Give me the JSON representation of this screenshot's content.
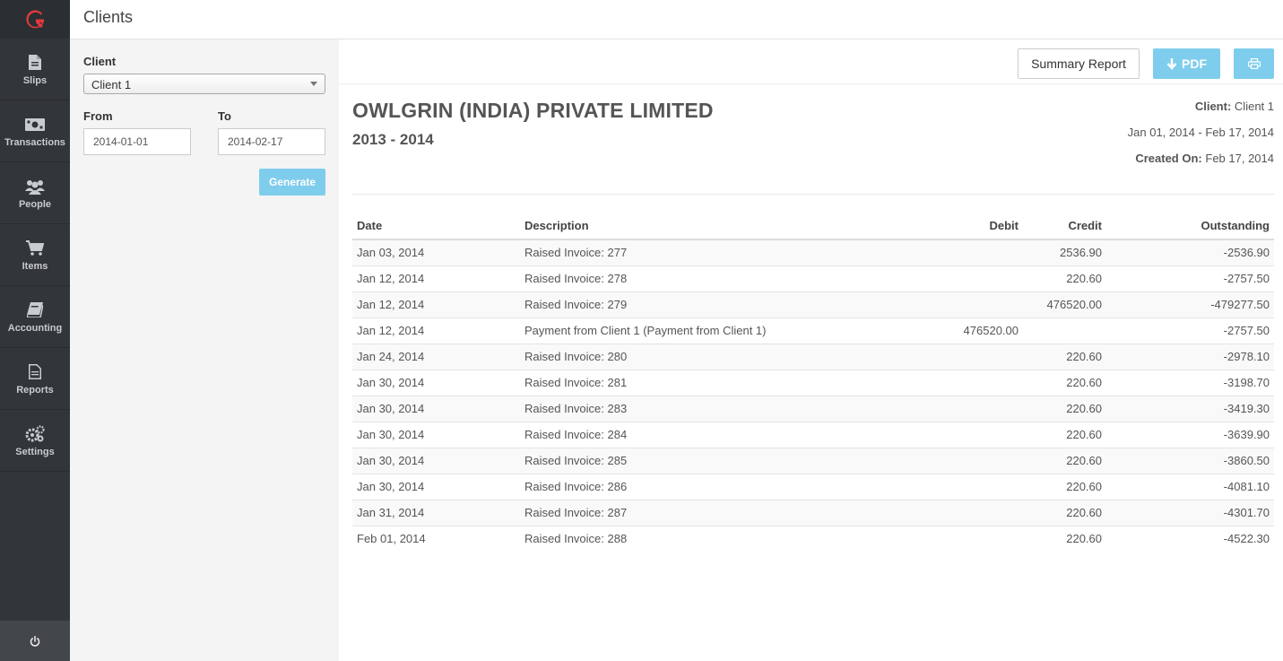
{
  "app": {
    "page_title": "Clients"
  },
  "sidebar": {
    "items": [
      {
        "label": "Slips",
        "icon": "file-icon"
      },
      {
        "label": "Transactions",
        "icon": "money-icon"
      },
      {
        "label": "People",
        "icon": "people-icon"
      },
      {
        "label": "Items",
        "icon": "cart-icon"
      },
      {
        "label": "Accounting",
        "icon": "book-icon"
      },
      {
        "label": "Reports",
        "icon": "report-icon"
      },
      {
        "label": "Settings",
        "icon": "gears-icon"
      }
    ]
  },
  "filter": {
    "client_label": "Client",
    "client_value": "Client 1",
    "from_label": "From",
    "from_value": "2014-01-01",
    "to_label": "To",
    "to_value": "2014-02-17",
    "generate_label": "Generate"
  },
  "toolbar": {
    "summary_label": "Summary Report",
    "pdf_label": "PDF"
  },
  "report": {
    "company": "OWLGRIN (INDIA) PRIVATE LIMITED",
    "fiscal_year": "2013 - 2014",
    "client_label": "Client:",
    "client_value": "Client 1",
    "range": "Jan 01, 2014 - Feb 17, 2014",
    "created_label": "Created On:",
    "created_value": "Feb 17, 2014"
  },
  "table": {
    "headers": [
      "Date",
      "Description",
      "Debit",
      "Credit",
      "Outstanding"
    ],
    "rows": [
      [
        "Jan 03, 2014",
        "Raised Invoice: 277",
        "",
        "2536.90",
        "-2536.90"
      ],
      [
        "Jan 12, 2014",
        "Raised Invoice: 278",
        "",
        "220.60",
        "-2757.50"
      ],
      [
        "Jan 12, 2014",
        "Raised Invoice: 279",
        "",
        "476520.00",
        "-479277.50"
      ],
      [
        "Jan 12, 2014",
        "Payment from Client 1 (Payment from Client 1)",
        "476520.00",
        "",
        "-2757.50"
      ],
      [
        "Jan 24, 2014",
        "Raised Invoice: 280",
        "",
        "220.60",
        "-2978.10"
      ],
      [
        "Jan 30, 2014",
        "Raised Invoice: 281",
        "",
        "220.60",
        "-3198.70"
      ],
      [
        "Jan 30, 2014",
        "Raised Invoice: 283",
        "",
        "220.60",
        "-3419.30"
      ],
      [
        "Jan 30, 2014",
        "Raised Invoice: 284",
        "",
        "220.60",
        "-3639.90"
      ],
      [
        "Jan 30, 2014",
        "Raised Invoice: 285",
        "",
        "220.60",
        "-3860.50"
      ],
      [
        "Jan 30, 2014",
        "Raised Invoice: 286",
        "",
        "220.60",
        "-4081.10"
      ],
      [
        "Jan 31, 2014",
        "Raised Invoice: 287",
        "",
        "220.60",
        "-4301.70"
      ],
      [
        "Feb 01, 2014",
        "Raised Invoice: 288",
        "",
        "220.60",
        "-4522.30"
      ]
    ]
  },
  "colors": {
    "accent": "#7fcdec",
    "brand": "#e0393e",
    "sidebar_bg": "#323539"
  }
}
